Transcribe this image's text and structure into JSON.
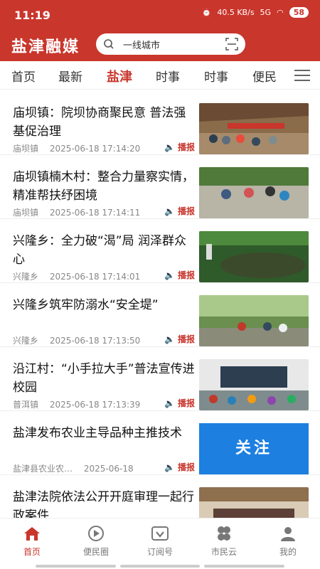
{
  "status": {
    "time": "11:19",
    "net": "40.5 KB/s",
    "signal": "5G",
    "battery": "58"
  },
  "header": {
    "brand": "盐津融媒",
    "search_placeholder": "一线城市"
  },
  "tabs": [
    "首页",
    "最新",
    "盐津",
    "时事",
    "时事",
    "便民"
  ],
  "active_tab": "盐津",
  "news": [
    {
      "title": "庙坝镇：院坝协商聚民意 普法强基促治理",
      "source": "庙坝镇",
      "time": "2025-06-18 17:14:20",
      "action": "播报"
    },
    {
      "title": "庙坝镇楠木村：整合力量察实情，精准帮扶纾困境",
      "source": "庙坝镇",
      "time": "2025-06-18 17:14:11",
      "action": "播报"
    },
    {
      "title": "兴隆乡：全力破“渴”局 润泽群众心",
      "source": "兴隆乡",
      "time": "2025-06-18 17:14:01",
      "action": "播报"
    },
    {
      "title": "兴隆乡筑牢防溺水“安全堤”",
      "source": "兴隆乡",
      "time": "2025-06-18 17:13:50",
      "action": "播报"
    },
    {
      "title": "沿江村：“小手拉大手”普法宣传进校园",
      "source": "普洱镇",
      "time": "2025-06-18 17:13:39",
      "action": "播报"
    },
    {
      "title": "盐津发布农业主导品种主推技术",
      "source": "盐津县农业农…",
      "time": "2025-06-18",
      "action": "播报",
      "thumb_label": "关注"
    },
    {
      "title": "盐津法院依法公开开庭审理一起行政案件",
      "source": "",
      "time": "",
      "action": ""
    }
  ],
  "bottom_nav": [
    {
      "label": "首页",
      "icon": "home-icon",
      "active": true
    },
    {
      "label": "便民圈",
      "icon": "play-circle-icon",
      "active": false
    },
    {
      "label": "订阅号",
      "icon": "heart-badge-icon",
      "active": false
    },
    {
      "label": "市民云",
      "icon": "clover-icon",
      "active": false
    },
    {
      "label": "我的",
      "icon": "person-icon",
      "active": false
    }
  ],
  "colors": {
    "brand": "#c9362c",
    "follow": "#1d7fe0"
  }
}
